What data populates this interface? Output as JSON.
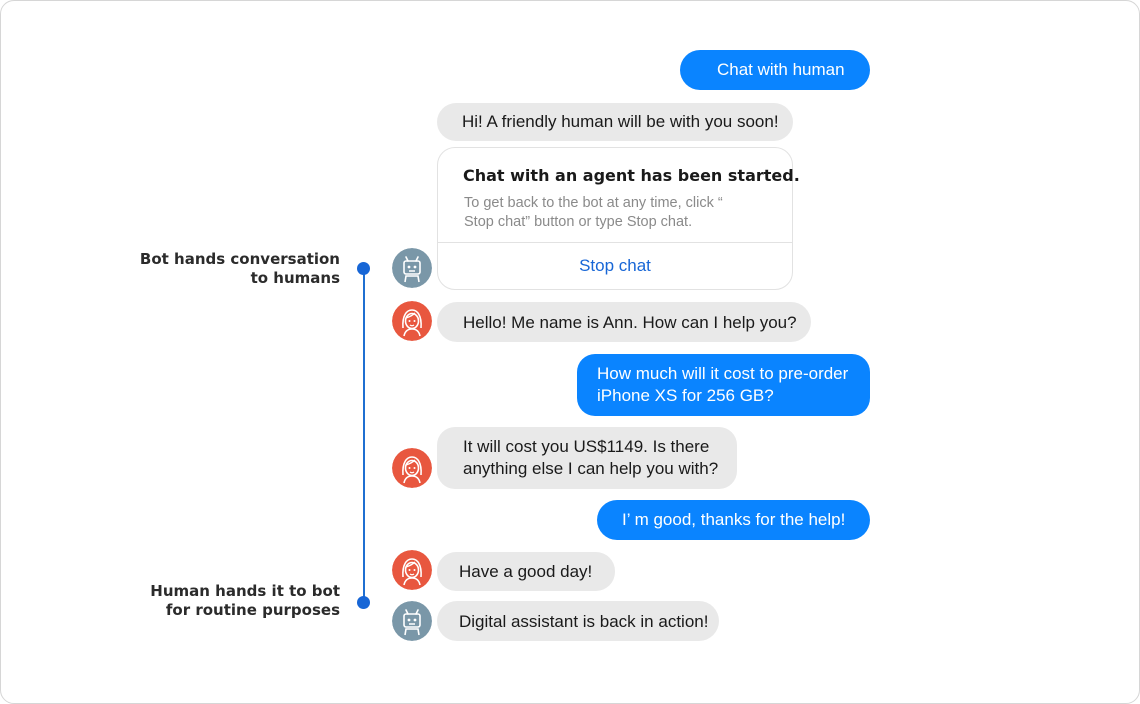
{
  "annotations": {
    "handoff_to_human": {
      "line1": "Bot hands conversation",
      "line2": "to humans"
    },
    "handoff_to_bot": {
      "line1": "Human hands it to bot",
      "line2": "for routine purposes"
    }
  },
  "messages": {
    "m1": "Chat with human",
    "m2": "Hi! A friendly human will be with you soon!",
    "m4": "Hello! Me name is Ann. How can I help you?",
    "m5": {
      "line1": "How much will it cost to pre-order",
      "line2": "iPhone XS for 256 GB?"
    },
    "m6": {
      "line1": "It will cost you US$1149. Is there",
      "line2": "anything else I can help you with?"
    },
    "m7": "I’ m good, thanks for the help!",
    "m8": "Have a good day!",
    "m9": "Digital assistant is back in action!"
  },
  "agent_card": {
    "title": "Chat with an agent has been started.",
    "desc_line1": "To get back to the bot at any time, click “",
    "desc_line2": "Stop chat” button or type Stop chat.",
    "button_label": "Stop chat"
  },
  "avatars": {
    "bot_icon": "robot-icon",
    "agent_icon": "woman-agent-icon",
    "bot_color": "#7a97a8",
    "agent_color": "#e8573f"
  },
  "colors": {
    "outgoing_bubble": "#0a84ff",
    "incoming_bubble": "#e9e9e9",
    "accent": "#1766d6"
  }
}
